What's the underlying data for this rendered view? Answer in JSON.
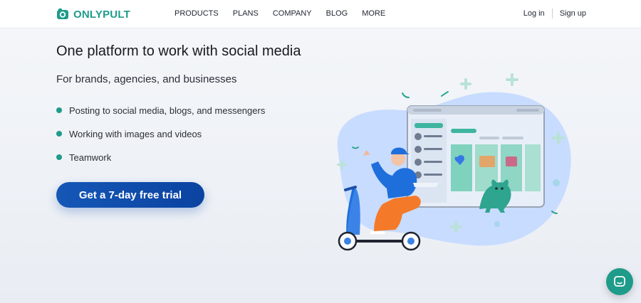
{
  "brand": {
    "name": "ONLYPULT",
    "accent": "#1f9b8a",
    "cta_color": "#1557b6"
  },
  "nav": {
    "items": [
      {
        "label": "PRODUCTS"
      },
      {
        "label": "PLANS"
      },
      {
        "label": "COMPANY"
      },
      {
        "label": "BLOG"
      },
      {
        "label": "MORE"
      }
    ]
  },
  "auth": {
    "login": "Log in",
    "signup": "Sign up"
  },
  "hero": {
    "title": "One platform to work with social media",
    "subtitle": "For brands, agencies, and businesses",
    "features": [
      "Posting to social media, blogs, and messengers",
      "Working with images and videos",
      "Teamwork"
    ],
    "cta": "Get a 7-day free trial"
  },
  "icons": {
    "logo": "camera-logo-icon",
    "chat": "chat-icon"
  }
}
